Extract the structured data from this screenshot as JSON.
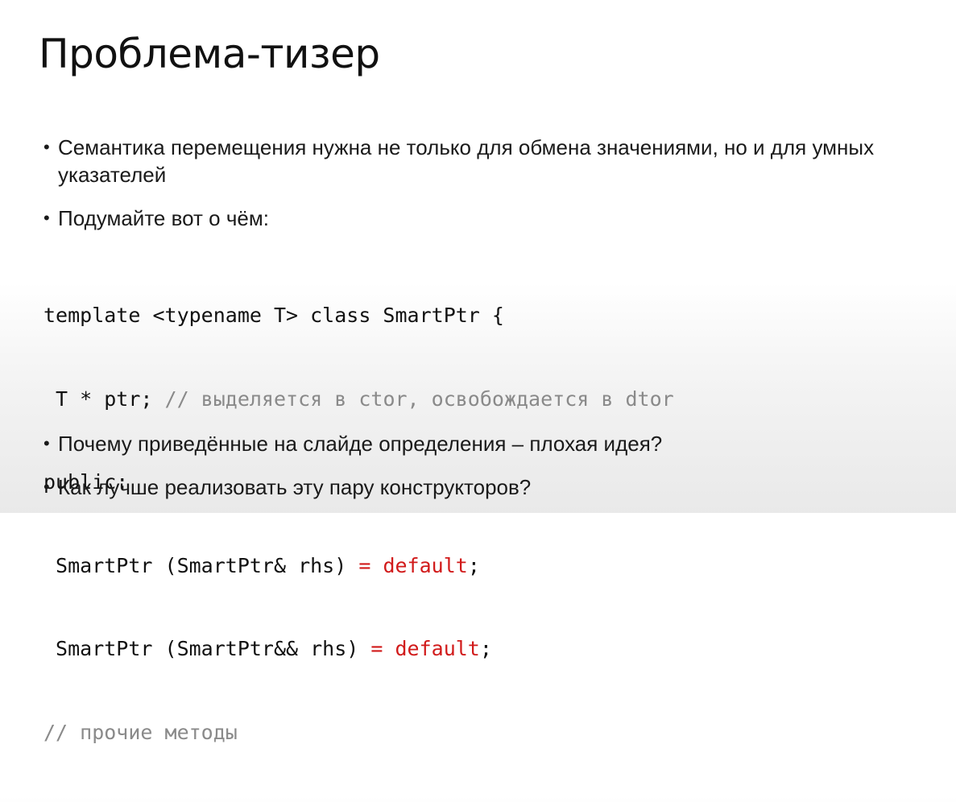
{
  "slide": {
    "title": "Проблема-тизер",
    "bullets": [
      "Семантика перемещения нужна не только для обмена значениями, но и для умных указателей",
      "Подумайте вот о чём:",
      "Почему приведённые на слайде определения – плохая идея?",
      "Как лучше реализовать эту пару конструкторов?"
    ],
    "bullet_marker": "•",
    "code": {
      "line1": "template <typename T> class SmartPtr {",
      "line2_code": " T * ptr; ",
      "line2_comment": "// выделяется в ctor, освобождается в dtor",
      "line3": "public:",
      "line4_code": " SmartPtr (SmartPtr& rhs) ",
      "line4_kw": "= default",
      "line4_end": ";",
      "line5_code": " SmartPtr (SmartPtr&& rhs) ",
      "line5_kw": "= default",
      "line5_end": ";",
      "line6_comment": "// прочие методы"
    }
  }
}
